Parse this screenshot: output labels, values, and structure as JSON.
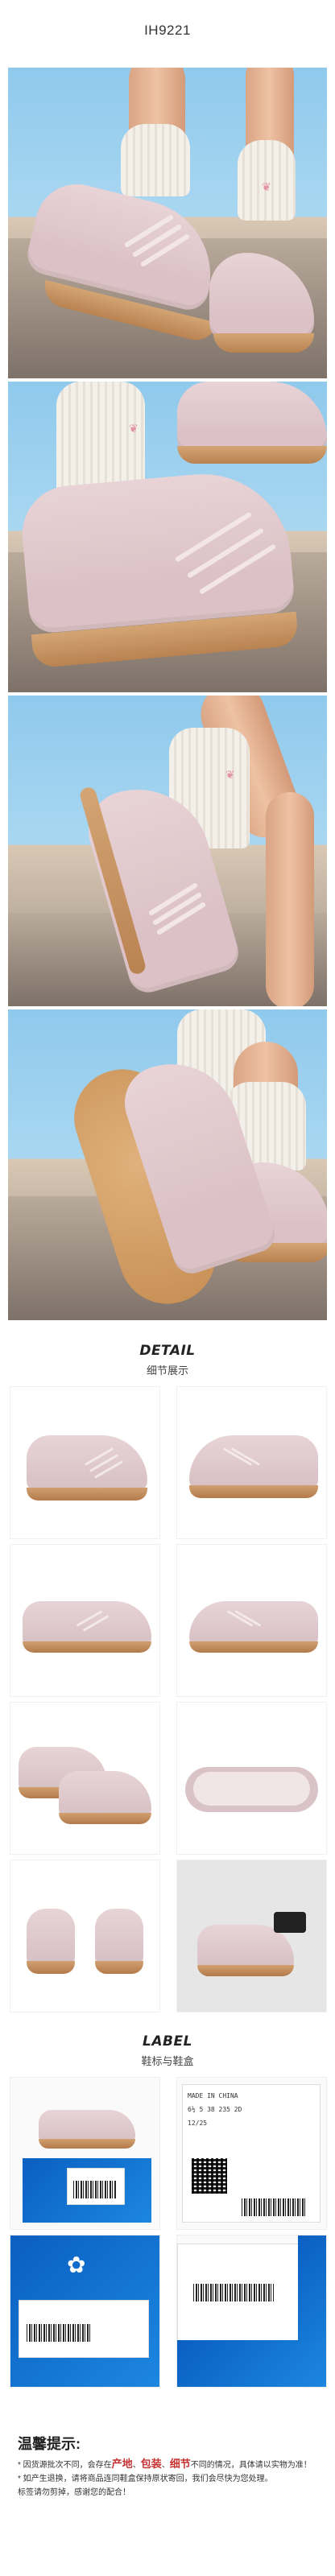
{
  "sku": "IH9221",
  "detail": {
    "title": "DETAIL",
    "subtitle": "细节展示"
  },
  "label": {
    "title": "LABEL",
    "subtitle": "鞋标与鞋盒"
  },
  "tag_text": {
    "made_in": "MADE IN CHINA",
    "sizes": "6½  5  38  235  2D",
    "date": "12/25"
  },
  "notice": {
    "title": "温馨提示:",
    "line1_prefix": "* 因货源批次不同，会存在",
    "kw1": "产地",
    "sep1": "、",
    "kw2": "包装",
    "sep2": "、",
    "kw3": "细节",
    "line1_suffix": "不同的情况，具体请以实物为准！",
    "line2": "* 如产生退换，请将商品连同鞋盒保持原状寄回，我们会尽快为您处理。",
    "line3": "  标签请勿剪掉，感谢您的配合！"
  },
  "colors": {
    "upper": "#e3cdd1",
    "sole": "#c8935f",
    "sky": "#9fd2ef",
    "box": "#0f6bcd",
    "accent": "#c83232"
  }
}
